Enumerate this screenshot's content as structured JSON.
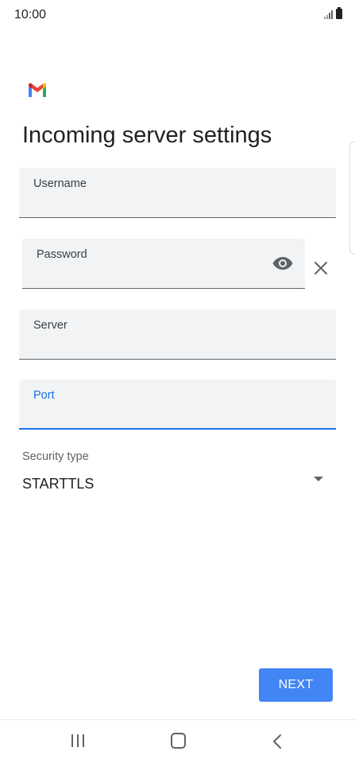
{
  "status_bar": {
    "time": "10:00"
  },
  "app": {
    "logo_icon": "gmail-logo-icon"
  },
  "page": {
    "title": "Incoming server settings"
  },
  "form": {
    "username": {
      "label": "Username",
      "value": ""
    },
    "password": {
      "label": "Password",
      "value": ""
    },
    "server": {
      "label": "Server",
      "value": ""
    },
    "port": {
      "label": "Port",
      "value": ""
    },
    "security_type": {
      "label": "Security type",
      "value": "STARTTLS"
    }
  },
  "actions": {
    "next_label": "NEXT"
  },
  "colors": {
    "accent": "#1a73e8",
    "button": "#4285f4",
    "field_bg": "#f1f3f4"
  },
  "icons": [
    "signal-icon",
    "battery-icon",
    "gmail-logo-icon",
    "eye-icon",
    "close-icon",
    "chevron-down-icon",
    "recents-icon",
    "home-icon",
    "back-icon"
  ]
}
